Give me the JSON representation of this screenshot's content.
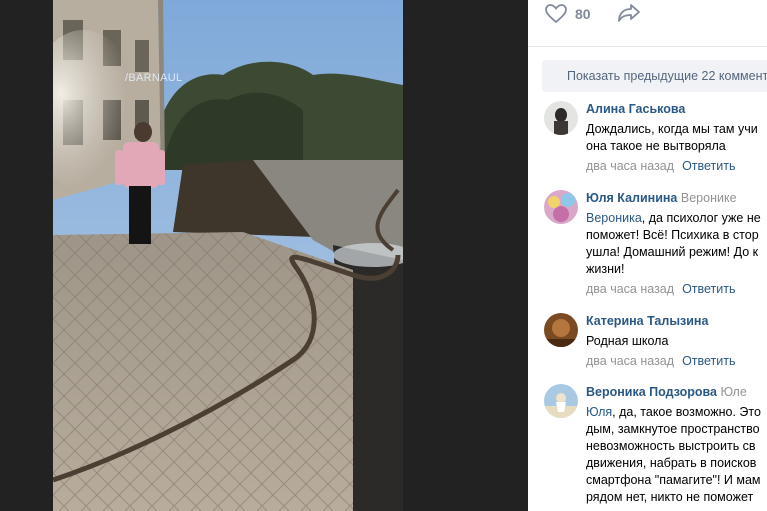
{
  "photo": {
    "watermark": "/BARNAUL"
  },
  "actions": {
    "like_count": "80"
  },
  "comments_panel": {
    "show_previous_label": "Показать предыдущие 22 коммент",
    "comments": [
      {
        "author": "Алина Гаськова",
        "reply_to": "",
        "mention": "",
        "lines": [
          "Дождались, когда мы там учи",
          "она такое не вытворяла"
        ],
        "time": "два часа назад",
        "reply_label": "Ответить"
      },
      {
        "author": "Юля Калинина",
        "reply_to": "Веронике",
        "mention": "Вероника",
        "lines": [
          ", да психолог уже не",
          "поможет! Всё! Психика в стор",
          "ушла! Домашний режим! До к",
          "жизни!"
        ],
        "time": "два часа назад",
        "reply_label": "Ответить"
      },
      {
        "author": "Катерина Талызина",
        "reply_to": "",
        "mention": "",
        "lines": [
          "Родная школа"
        ],
        "time": "два часа назад",
        "reply_label": "Ответить"
      },
      {
        "author": "Вероника Подзорова",
        "reply_to": "Юле",
        "mention": "Юля",
        "lines": [
          ", да, такое возможно. Это",
          "дым, замкнутое пространство",
          "невозможность выстроить св",
          "движения, набрать в поисков",
          "смартфона \"памагите\"! И мам",
          "рядом нет, никто не поможет"
        ],
        "time": "",
        "reply_label": ""
      }
    ]
  },
  "colors": {
    "link": "#2a5885",
    "muted": "#939393",
    "panel_bg": "#ffffff",
    "viewer_bg": "#222222"
  }
}
